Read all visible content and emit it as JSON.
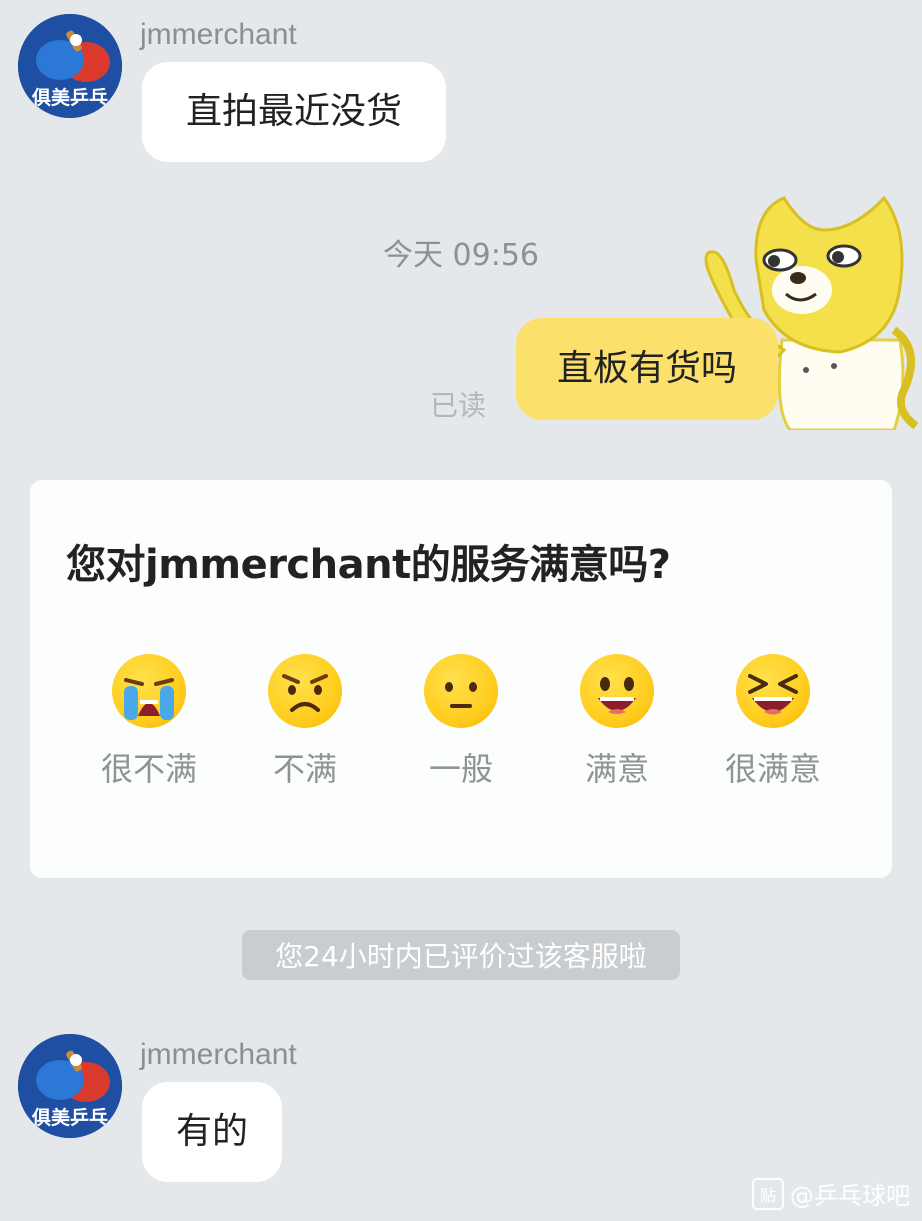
{
  "messages": [
    {
      "sender": "jmmerchant",
      "text": "直拍最近没货",
      "direction": "incoming"
    },
    {
      "timestamp": "今天  09:56"
    },
    {
      "text": "直板有货吗",
      "direction": "outgoing",
      "status": "已读"
    },
    {
      "sender": "jmmerchant",
      "text": "有的",
      "direction": "incoming"
    }
  ],
  "avatar": {
    "brand_text": "俱美乒乓",
    "icon": "table-tennis-paddle-icon",
    "bg": "#1f4fa3"
  },
  "sticker": {
    "icon": "doge-sticker",
    "color": "#f4e04a"
  },
  "survey": {
    "question": "您对jmmerchant的服务满意吗?",
    "options": [
      {
        "label": "很不满",
        "icon": "crying-face-icon"
      },
      {
        "label": "不满",
        "icon": "frowning-face-icon"
      },
      {
        "label": "一般",
        "icon": "neutral-face-icon"
      },
      {
        "label": "满意",
        "icon": "smiling-face-icon"
      },
      {
        "label": "很满意",
        "icon": "grinning-squinting-face-icon"
      }
    ]
  },
  "notice": "您24小时内已评价过该客服啦",
  "watermark": {
    "box": "贴",
    "text": "@乒乓球吧"
  },
  "colors": {
    "background": "#e4e8ea",
    "outgoing_bubble": "#fbe06c",
    "incoming_bubble": "#ffffff"
  }
}
